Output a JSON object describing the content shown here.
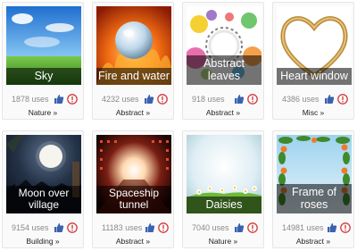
{
  "cards": [
    {
      "title": "Sky",
      "uses": "1878 uses",
      "category": "Nature »"
    },
    {
      "title": "Fire and water",
      "uses": "4232 uses",
      "category": "Abstract »"
    },
    {
      "title": "Abstract leaves",
      "uses": "918 uses",
      "category": "Abstract »"
    },
    {
      "title": "Heart window",
      "uses": "4386 uses",
      "category": "Misc »"
    },
    {
      "title": "Moon over village",
      "uses": "9154 uses",
      "category": "Building »"
    },
    {
      "title": "Spaceship tunnel",
      "uses": "11183 uses",
      "category": "Abstract »"
    },
    {
      "title": "Daisies",
      "uses": "7040 uses",
      "category": "Nature »"
    },
    {
      "title": "Frame of roses",
      "uses": "14981 uses",
      "category": "Abstract »"
    }
  ],
  "colors": {
    "like_icon": "#3b62b0",
    "flag_icon": "#d23a3a"
  },
  "icons": {
    "like": "thumbs-up-icon",
    "flag": "exclamation-icon"
  }
}
